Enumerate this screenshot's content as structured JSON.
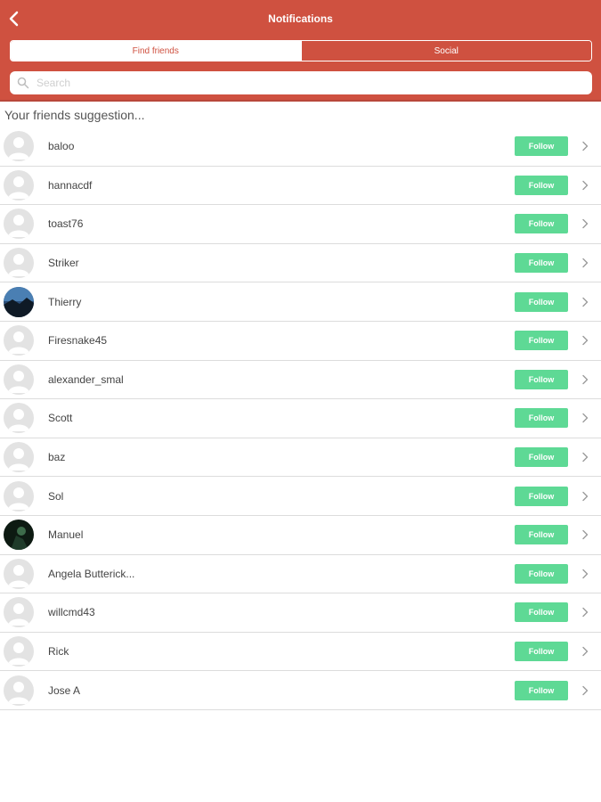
{
  "header": {
    "title": "Notifications",
    "back_icon": "chevron-left-icon",
    "background": "#cf5140"
  },
  "tabs": [
    {
      "label": "Find friends",
      "active": true
    },
    {
      "label": "Social",
      "active": false
    }
  ],
  "search": {
    "placeholder": "Search",
    "value": "",
    "icon": "search-icon"
  },
  "section_title": "Your friends suggestion...",
  "follow_color": "#5ed995",
  "users": [
    {
      "name": "baloo",
      "follow_label": "Follow",
      "avatar": "default"
    },
    {
      "name": "hannacdf",
      "follow_label": "Follow",
      "avatar": "default"
    },
    {
      "name": "toast76",
      "follow_label": "Follow",
      "avatar": "default"
    },
    {
      "name": "Striker",
      "follow_label": "Follow",
      "avatar": "default"
    },
    {
      "name": "Thierry",
      "follow_label": "Follow",
      "avatar": "photo-landscape"
    },
    {
      "name": "Firesnake45",
      "follow_label": "Follow",
      "avatar": "default"
    },
    {
      "name": "alexander_smal",
      "follow_label": "Follow",
      "avatar": "default"
    },
    {
      "name": "Scott",
      "follow_label": "Follow",
      "avatar": "default"
    },
    {
      "name": "baz",
      "follow_label": "Follow",
      "avatar": "default"
    },
    {
      "name": "Sol",
      "follow_label": "Follow",
      "avatar": "default"
    },
    {
      "name": "Manuel",
      "follow_label": "Follow",
      "avatar": "photo-dark"
    },
    {
      "name": "Angela  Butterick...",
      "follow_label": "Follow",
      "avatar": "default"
    },
    {
      "name": "willcmd43",
      "follow_label": "Follow",
      "avatar": "default"
    },
    {
      "name": "Rick",
      "follow_label": "Follow",
      "avatar": "default"
    },
    {
      "name": "Jose A",
      "follow_label": "Follow",
      "avatar": "default"
    }
  ]
}
